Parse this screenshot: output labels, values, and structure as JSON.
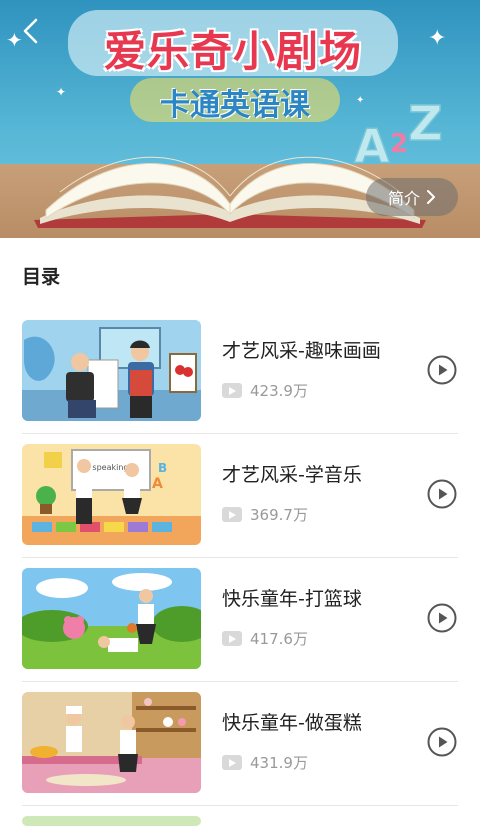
{
  "banner": {
    "title": "爱乐奇小剧场",
    "subtitle": "卡通英语课",
    "letters": "A2Z",
    "intro_label": "简介"
  },
  "catalog": {
    "heading": "目录",
    "items": [
      {
        "title": "才艺风采-趣味画画",
        "plays": "423.9万"
      },
      {
        "title": "才艺风采-学音乐",
        "plays": "369.7万",
        "board_text": "It's speaking..."
      },
      {
        "title": "快乐童年-打篮球",
        "plays": "417.6万"
      },
      {
        "title": "快乐童年-做蛋糕",
        "plays": "431.9万"
      }
    ]
  },
  "icons": {
    "back": "chevron-left-icon",
    "intro_arrow": "chevron-right-icon",
    "play": "play-circle-icon",
    "play_count": "video-icon"
  },
  "colors": {
    "title_red": "#e8384f",
    "subtitle_blue": "#2c86c4",
    "sky": "#4aa9d1"
  }
}
